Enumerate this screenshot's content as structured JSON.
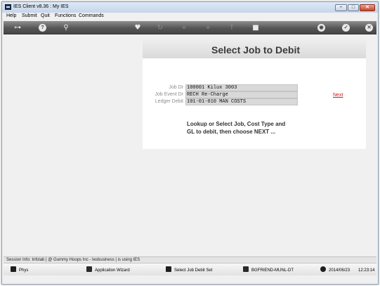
{
  "window": {
    "title": "IES Client v8.36 : My IES",
    "controls": {
      "minimize": "–",
      "maximize": "□",
      "close": "✕"
    }
  },
  "menu": {
    "items": [
      "Help",
      "Submit",
      "Quit",
      "Functions",
      "Commands"
    ]
  },
  "toolbar": {
    "icons": [
      "key-icon",
      "info-icon",
      "search-icon",
      "heart-icon",
      "refresh-icon",
      "rewind-icon",
      "fast-forward-icon",
      "up-arrow-icon",
      "stop-icon",
      "globe-icon",
      "check-icon",
      "close-icon"
    ]
  },
  "panel": {
    "title": "Select Job to Debit",
    "fields": [
      {
        "label": "Job Dr",
        "value": "100001 Kilux 3003"
      },
      {
        "label": "Job Event Dr",
        "value": "RECH Re-Charge"
      },
      {
        "label": "Ledger Debit",
        "value": "101-01-010 MAN COSTS"
      }
    ],
    "next_label": "Next",
    "instruction_line1": "Lookup or Select Job, Cost Type and",
    "instruction_line2": "GL to debit, then choose NEXT ..."
  },
  "status": {
    "session_info": "Session Info: Infolab | @ Gummy Hoops Inc   - Iesbusiness | is using IES"
  },
  "taskbar": {
    "phys": "Phys",
    "app_wizard": "Application Wizard",
    "current_task": "Select Job Debit Set",
    "machine": "BGFRIEND-MUNL-DT",
    "date": "2014/06/23",
    "time": "12:23:14"
  }
}
